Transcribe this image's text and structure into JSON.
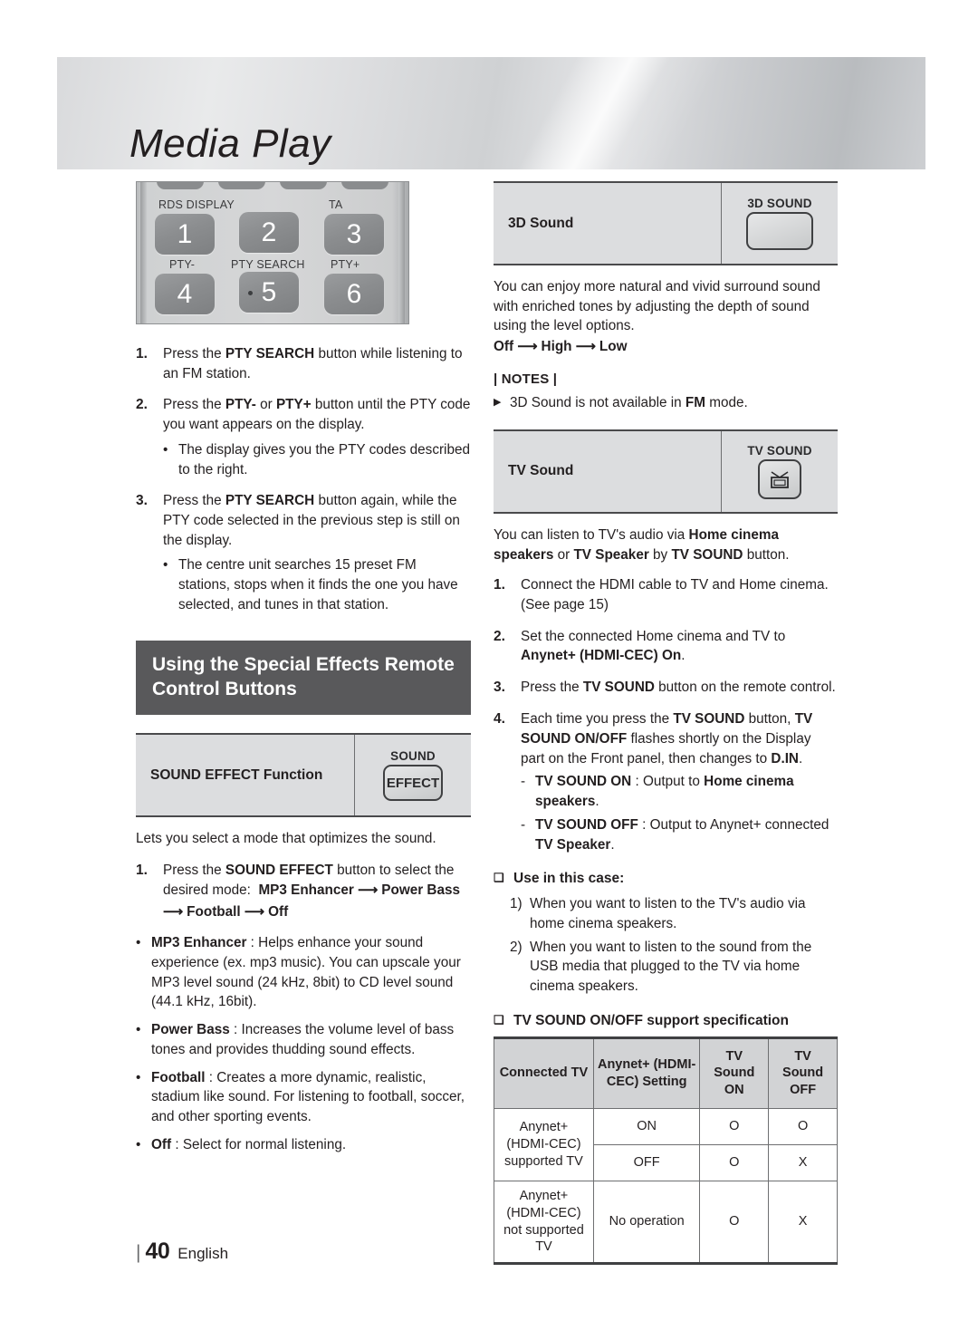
{
  "banner": {
    "title": "Media Play"
  },
  "remote": {
    "labels": {
      "rds": "RDS DISPLAY",
      "ta": "TA",
      "pty_minus": "PTY-",
      "pty_search": "PTY SEARCH",
      "pty_plus": "PTY+"
    },
    "keys": [
      "1",
      "2",
      "3",
      "4",
      "5",
      "6"
    ]
  },
  "pty_steps": [
    {
      "n": "1.",
      "html": "Press the <b>PTY SEARCH</b> button while listening to an FM station.",
      "subs": []
    },
    {
      "n": "2.",
      "html": "Press the <b>PTY-</b> or <b>PTY+</b> button until the PTY code you want appears on the display.",
      "subs": [
        "The display gives you the PTY codes described to the right."
      ]
    },
    {
      "n": "3.",
      "html": "Press the <b>PTY SEARCH</b> button again, while the PTY code selected in the previous step is still on the display.",
      "subs": [
        "The centre unit searches 15 preset FM stations, stops when it finds the one you have selected, and tunes in that station."
      ]
    }
  ],
  "section_heading": "Using the Special Effects Remote Control Buttons",
  "sound_effect": {
    "row_name": "SOUND EFFECT Function",
    "art_label": "SOUND",
    "art_key_text": "EFFECT",
    "desc": "Lets you select a mode that optimizes the sound.",
    "step": {
      "n": "1.",
      "html": "Press the <b>SOUND EFFECT</b> button to select the desired mode: &nbsp;<b>MP3 Enhancer &#10230; Power Bass</b>"
    },
    "step_arrow_line": "&#10230; Football &#10230; Off",
    "modes": [
      "<b>MP3 Enhancer</b> : Helps enhance your sound experience (ex. mp3 music). You can upscale your MP3 level sound (24 kHz, 8bit) to CD level sound (44.1 kHz, 16bit).",
      "<b>Power Bass</b> : Increases the volume level of bass tones and provides thudding sound effects.",
      "<b>Football</b> : Creates a more dynamic, realistic, stadium like sound. For listening to football, soccer, and other sporting events.",
      "<b>Off</b> : Select for normal listening."
    ]
  },
  "sound_3d": {
    "row_name": "3D Sound",
    "art_label": "3D SOUND",
    "desc": "You can enjoy more natural and vivid surround sound with enriched tones by adjusting the depth of sound using the level options.",
    "levels": "Off &#10230; High &#10230; Low",
    "notes_title": "| NOTES |",
    "notes": [
      "3D Sound is not available in <b>FM</b> mode."
    ]
  },
  "tv_sound": {
    "row_name": "TV Sound",
    "art_label": "TV SOUND",
    "desc": "You can listen to TV's audio via <b>Home cinema speakers</b> or <b>TV Speaker</b> by <b>TV SOUND</b> button.",
    "steps": [
      {
        "n": "1.",
        "html": "Connect the HDMI cable to TV and Home cinema. (See page 15)"
      },
      {
        "n": "2.",
        "html": "Set the connected Home cinema and TV to <b>Anynet+ (HDMI-CEC) On</b>."
      },
      {
        "n": "3.",
        "html": "Press the <b>TV SOUND</b> button on the remote control."
      },
      {
        "n": "4.",
        "html": "Each time you press the <b>TV SOUND</b> button, <b>TV SOUND ON/OFF</b> flashes shortly on the Display part on the Front panel, then changes to <b>D.IN</b>."
      }
    ],
    "dashes": [
      "<b>TV SOUND ON</b> : Output to <b>Home cinema speakers</b>.",
      "<b>TV SOUND OFF</b> : Output to Anynet+ connected <b>TV Speaker</b>."
    ],
    "use_case_title": "Use in this case:",
    "use_cases": [
      {
        "n": "1)",
        "text": "When you want to listen to the TV's audio via home cinema speakers."
      },
      {
        "n": "2)",
        "text": "When you want to listen to the sound from the USB media that plugged to the TV via home cinema speakers."
      }
    ],
    "spec_title": "TV SOUND ON/OFF support specification",
    "spec_table": {
      "headers": [
        "Connected TV",
        "Anynet+ (HDMI-CEC) Setting",
        "TV Sound ON",
        "TV Sound OFF"
      ],
      "rows": [
        {
          "connected_tv": "Anynet+ (HDMI-CEC) supported TV",
          "setting": "ON",
          "on": "O",
          "off": "O"
        },
        {
          "connected_tv": "",
          "setting": "OFF",
          "on": "O",
          "off": "X"
        },
        {
          "connected_tv": "Anynet+ (HDMI-CEC) not supported TV",
          "setting": "No operation",
          "on": "O",
          "off": "X"
        }
      ]
    }
  },
  "footer": {
    "bar": "|",
    "page": "40",
    "language": "English"
  }
}
